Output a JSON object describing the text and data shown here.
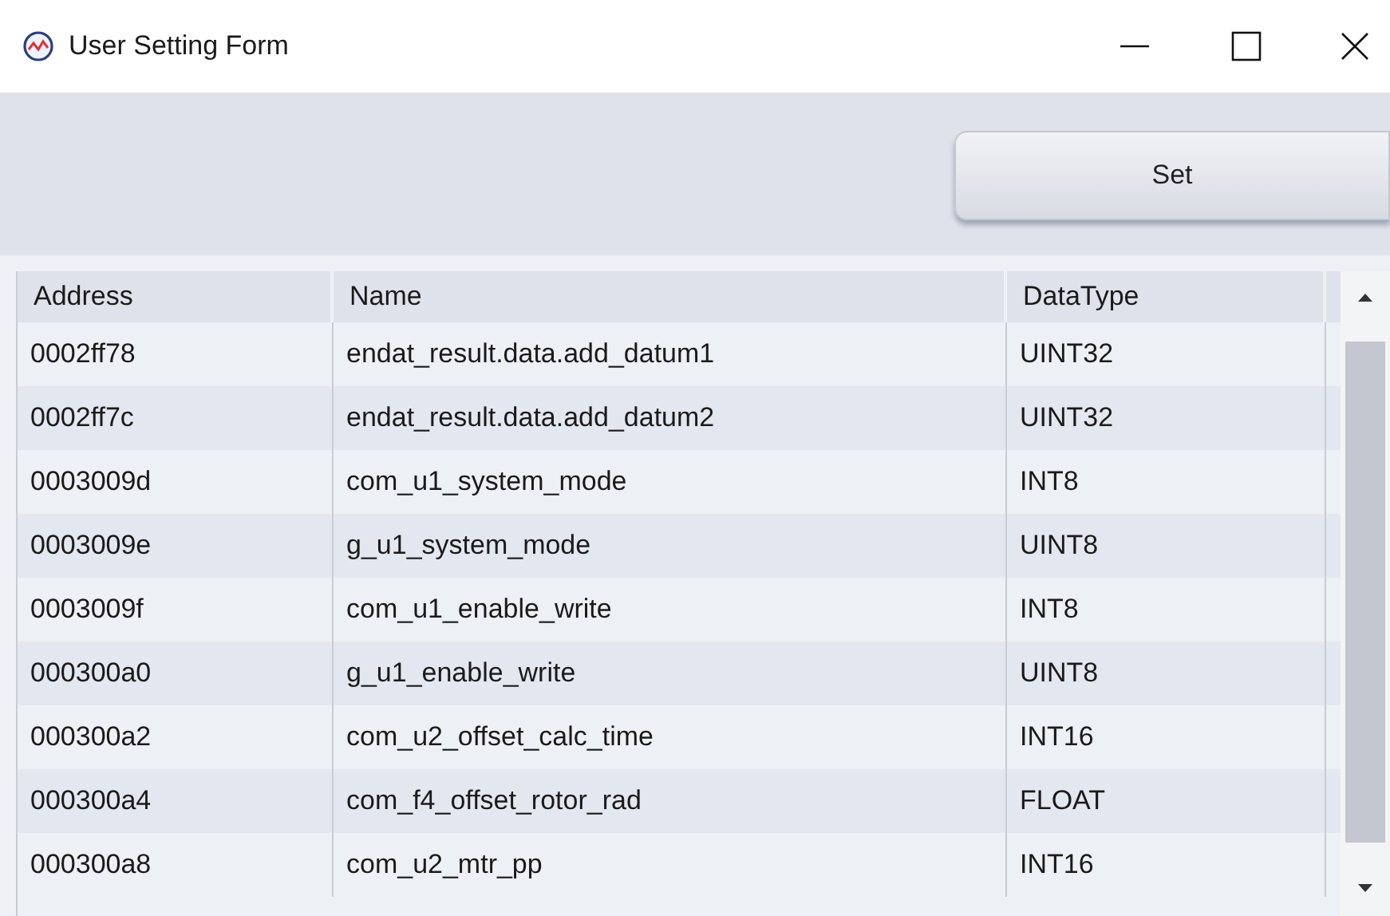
{
  "window": {
    "title": "User Setting Form"
  },
  "toolbar": {
    "buttons": [
      {
        "label": "Set"
      }
    ]
  },
  "table": {
    "columns": [
      "Address",
      "Name",
      "DataType"
    ],
    "rows": [
      {
        "address": "0002ff78",
        "name": "endat_result.data.add_datum1",
        "data_type": "UINT32"
      },
      {
        "address": "0002ff7c",
        "name": "endat_result.data.add_datum2",
        "data_type": "UINT32"
      },
      {
        "address": "0003009d",
        "name": "com_u1_system_mode",
        "data_type": "INT8"
      },
      {
        "address": "0003009e",
        "name": "g_u1_system_mode",
        "data_type": "UINT8"
      },
      {
        "address": "0003009f",
        "name": "com_u1_enable_write",
        "data_type": "INT8"
      },
      {
        "address": "000300a0",
        "name": "g_u1_enable_write",
        "data_type": "UINT8"
      },
      {
        "address": "000300a2",
        "name": "com_u2_offset_calc_time",
        "data_type": "INT16"
      },
      {
        "address": "000300a4",
        "name": "com_f4_offset_rotor_rad",
        "data_type": "FLOAT"
      },
      {
        "address": "000300a8",
        "name": "com_u2_mtr_pp",
        "data_type": "INT16"
      }
    ]
  }
}
